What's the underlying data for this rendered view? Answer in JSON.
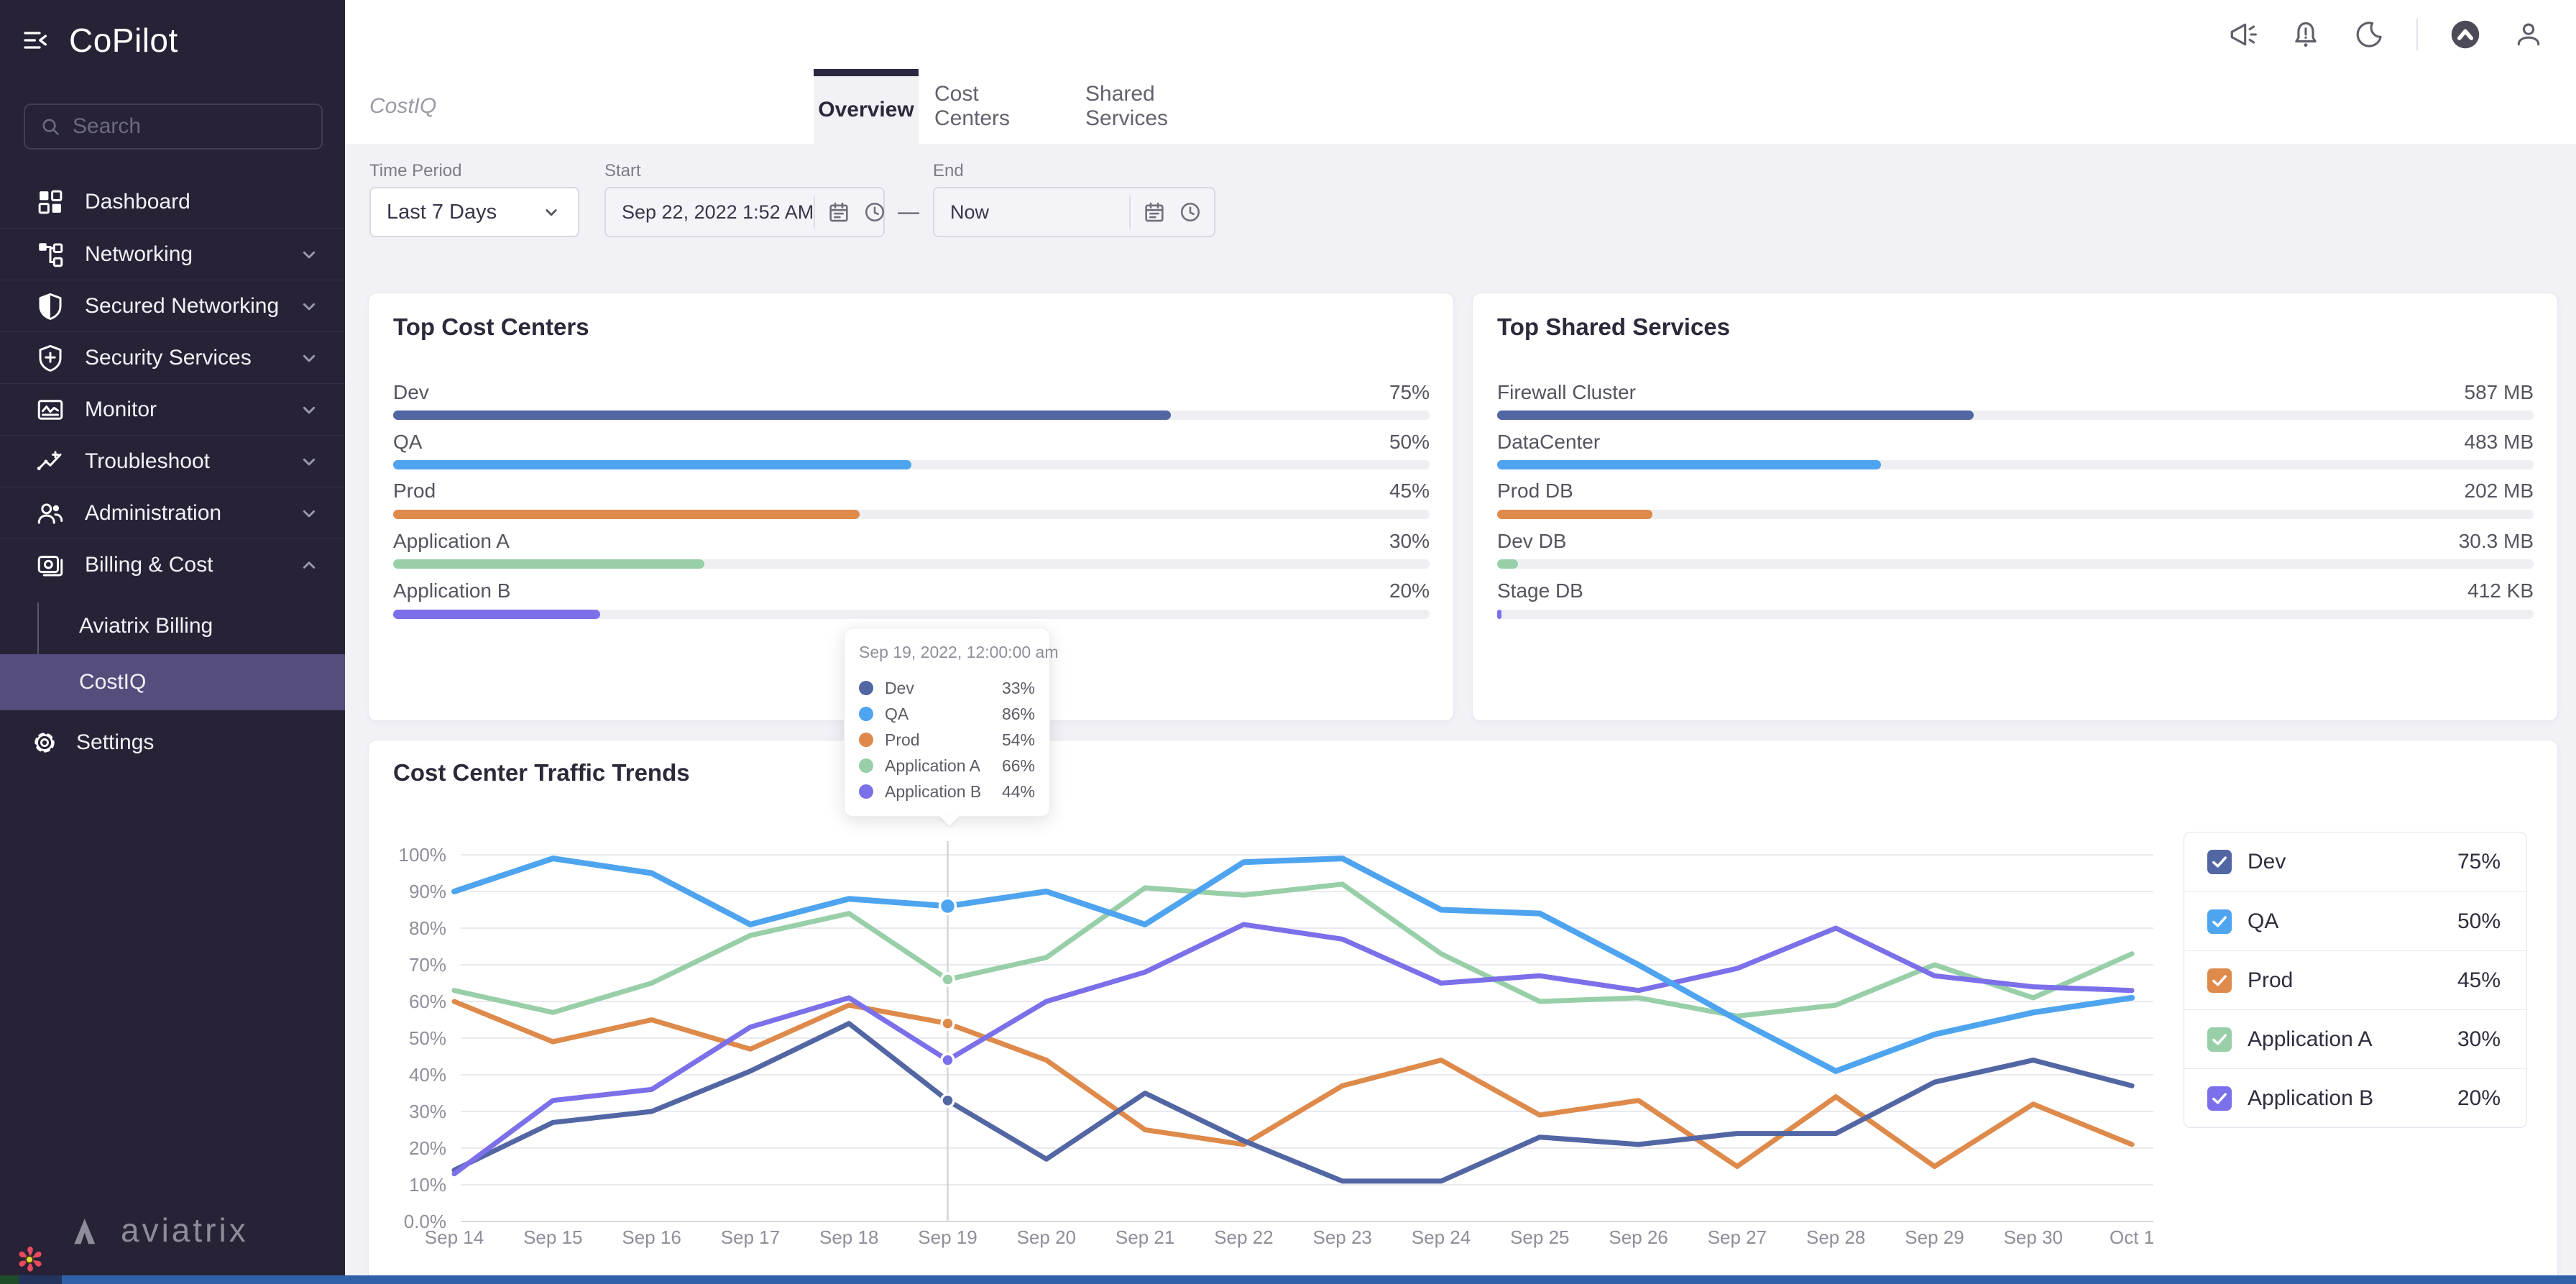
{
  "app": {
    "title": "CoPilot"
  },
  "sidebar": {
    "search_placeholder": "Search",
    "items": [
      {
        "label": "Dashboard",
        "icon": "dashboard",
        "expandable": false
      },
      {
        "label": "Networking",
        "icon": "networking",
        "expandable": true
      },
      {
        "label": "Secured Networking",
        "icon": "shield-half",
        "expandable": true
      },
      {
        "label": "Security Services",
        "icon": "shield-plus",
        "expandable": true
      },
      {
        "label": "Monitor",
        "icon": "monitor",
        "expandable": true
      },
      {
        "label": "Troubleshoot",
        "icon": "trend",
        "expandable": true
      },
      {
        "label": "Administration",
        "icon": "people",
        "expandable": true
      },
      {
        "label": "Billing & Cost",
        "icon": "billing",
        "expandable": true,
        "expanded": true
      }
    ],
    "subitems": [
      {
        "label": "Aviatrix Billing",
        "selected": false
      },
      {
        "label": "CostIQ",
        "selected": true
      }
    ],
    "settings_label": "Settings",
    "logo_text": "aviatrix"
  },
  "topbar": {
    "icons": [
      {
        "name": "megaphone"
      },
      {
        "name": "notifications-bell"
      },
      {
        "name": "dark-mode-moon"
      },
      {
        "name": "aviatrix-mark"
      },
      {
        "name": "user-profile"
      }
    ]
  },
  "tabs": {
    "group_label": "CostIQ",
    "items": [
      {
        "label": "Overview",
        "active": true
      },
      {
        "label": "Cost Centers",
        "active": false
      },
      {
        "label": "Shared Services",
        "active": false
      }
    ]
  },
  "filters": {
    "time_period_label": "Time Period",
    "time_period_value": "Last 7 Days",
    "start_label": "Start",
    "start_value": "Sep 22, 2022 1:52 AM",
    "end_label": "End",
    "end_value": "Now",
    "separator": "—"
  },
  "cost_centers_card": {
    "title": "Top Cost Centers",
    "rows": [
      {
        "label": "Dev",
        "value": "75%",
        "bar_percent": 75,
        "color": "#5366a4"
      },
      {
        "label": "QA",
        "value": "50%",
        "bar_percent": 50,
        "color": "#4ea4ef"
      },
      {
        "label": "Prod",
        "value": "45%",
        "bar_percent": 45,
        "color": "#de8a4b"
      },
      {
        "label": "Application A",
        "value": "30%",
        "bar_percent": 30,
        "color": "#98cfa8"
      },
      {
        "label": "Application B",
        "value": "20%",
        "bar_percent": 20,
        "color": "#7b70e9"
      }
    ]
  },
  "shared_services_card": {
    "title": "Top Shared Services",
    "rows": [
      {
        "label": "Firewall Cluster",
        "value": "587 MB",
        "bar_percent": 46,
        "color": "#5366a4"
      },
      {
        "label": "DataCenter",
        "value": "483 MB",
        "bar_percent": 37,
        "color": "#4ea4ef"
      },
      {
        "label": "Prod DB",
        "value": "202 MB",
        "bar_percent": 15,
        "color": "#de8a4b"
      },
      {
        "label": "Dev DB",
        "value": "30.3 MB",
        "bar_percent": 2,
        "color": "#98cfa8"
      },
      {
        "label": "Stage DB",
        "value": "412 KB",
        "bar_percent": 0.4,
        "color": "#7b70e9"
      }
    ]
  },
  "trends_card": {
    "title": "Cost Center Traffic Trends"
  },
  "legend": {
    "items": [
      {
        "label": "Dev",
        "value": "75%",
        "color": "#5366a4"
      },
      {
        "label": "QA",
        "value": "50%",
        "color": "#4ea4ef"
      },
      {
        "label": "Prod",
        "value": "45%",
        "color": "#de8a4b"
      },
      {
        "label": "Application A",
        "value": "30%",
        "color": "#98cfa8"
      },
      {
        "label": "Application B",
        "value": "20%",
        "color": "#7b70e9"
      }
    ]
  },
  "tooltip": {
    "title": "Sep 19, 2022, 12:00:00 am",
    "rows": [
      {
        "label": "Dev",
        "value": "33%",
        "color": "#5366a4"
      },
      {
        "label": "QA",
        "value": "86%",
        "color": "#4ea4ef"
      },
      {
        "label": "Prod",
        "value": "54%",
        "color": "#de8a4b"
      },
      {
        "label": "Application A",
        "value": "66%",
        "color": "#98cfa8"
      },
      {
        "label": "Application B",
        "value": "44%",
        "color": "#7b70e9"
      }
    ]
  },
  "chart_data": {
    "type": "line",
    "title": "Cost Center Traffic Trends",
    "x": [
      "Sep 14",
      "Sep 15",
      "Sep 16",
      "Sep 17",
      "Sep 18",
      "Sep 19",
      "Sep 20",
      "Sep 21",
      "Sep 22",
      "Sep 23",
      "Sep 24",
      "Sep 25",
      "Sep 26",
      "Sep 27",
      "Sep 28",
      "Sep 29",
      "Sep 30",
      "Oct 1"
    ],
    "y_ticks": [
      "0.0%",
      "10%",
      "20%",
      "30%",
      "40%",
      "50%",
      "60%",
      "70%",
      "80%",
      "90%",
      "100%"
    ],
    "ylim": [
      0,
      100
    ],
    "grid": "horizontal",
    "legend_position": "right",
    "hover_index": 5,
    "series": [
      {
        "name": "Dev",
        "color": "#5366a4",
        "values": [
          14,
          27,
          30,
          41,
          54,
          33,
          17,
          35,
          22,
          11,
          11,
          23,
          21,
          24,
          24,
          38,
          44,
          37
        ]
      },
      {
        "name": "QA",
        "color": "#4ea4ef",
        "values": [
          90,
          99,
          95,
          81,
          88,
          86,
          90,
          81,
          98,
          99,
          85,
          84,
          70,
          55,
          41,
          51,
          57,
          61
        ]
      },
      {
        "name": "Prod",
        "color": "#de8a4b",
        "values": [
          60,
          49,
          55,
          47,
          59,
          54,
          44,
          25,
          21,
          37,
          44,
          29,
          33,
          15,
          34,
          15,
          32,
          21
        ]
      },
      {
        "name": "Application A",
        "color": "#98cfa8",
        "values": [
          63,
          57,
          65,
          78,
          84,
          66,
          72,
          91,
          89,
          92,
          73,
          60,
          61,
          56,
          59,
          70,
          61,
          73
        ]
      },
      {
        "name": "Application B",
        "color": "#7b70e9",
        "values": [
          13,
          33,
          36,
          53,
          61,
          44,
          60,
          68,
          81,
          77,
          65,
          67,
          63,
          69,
          80,
          67,
          64,
          63
        ]
      }
    ]
  }
}
